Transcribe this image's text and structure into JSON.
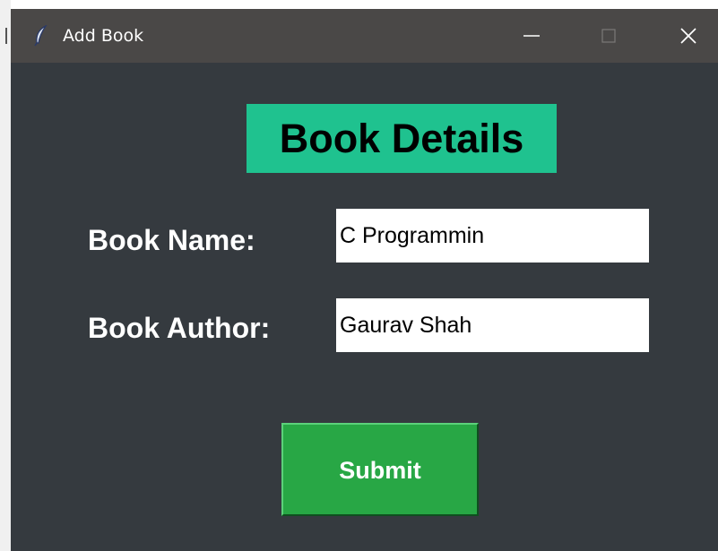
{
  "window": {
    "title": "Add Book",
    "icon": "feather-icon"
  },
  "form": {
    "heading": "Book Details",
    "name_label": "Book Name:",
    "name_value": "C Programmin",
    "author_label": "Book Author:",
    "author_value": "Gaurav Shah",
    "submit_label": "Submit"
  },
  "colors": {
    "background": "#353a3f",
    "titlebar": "#4a4847",
    "heading_bg": "#1fc28f",
    "submit_bg": "#28a745"
  }
}
